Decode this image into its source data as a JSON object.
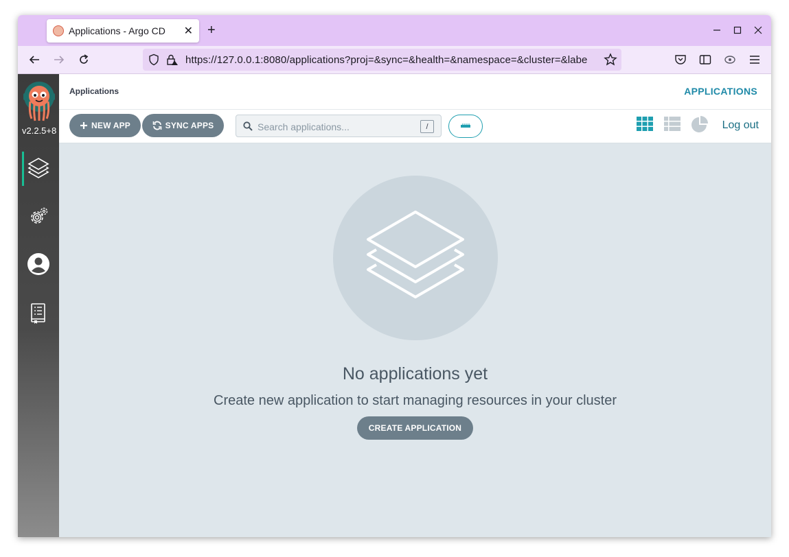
{
  "browser": {
    "tab_title": "Applications - Argo CD",
    "tab_close": "✕",
    "new_tab": "+",
    "url": "https://127.0.0.1:8080/applications?proj=&sync=&health=&namespace=&cluster=&labe"
  },
  "sidebar": {
    "version": "v2.2.5+8",
    "items": [
      {
        "name": "applications",
        "icon": "layers-icon",
        "active": true
      },
      {
        "name": "settings",
        "icon": "gear-icon",
        "active": false
      },
      {
        "name": "user-info",
        "icon": "user-icon",
        "active": false
      },
      {
        "name": "documentation",
        "icon": "book-icon",
        "active": false
      }
    ]
  },
  "header": {
    "breadcrumb": "Applications",
    "title": "APPLICATIONS"
  },
  "toolbar": {
    "new_app": "NEW APP",
    "sync_apps": "SYNC APPS",
    "search_placeholder": "Search applications...",
    "search_shortcut": "/",
    "logout": "Log out"
  },
  "empty_state": {
    "title": "No applications yet",
    "subtitle": "Create new application to start managing resources in your cluster",
    "button": "CREATE APPLICATION"
  },
  "colors": {
    "accent": "#1f9fb0",
    "button": "#6d7f8b",
    "titlebar": "#e3c4f7"
  }
}
